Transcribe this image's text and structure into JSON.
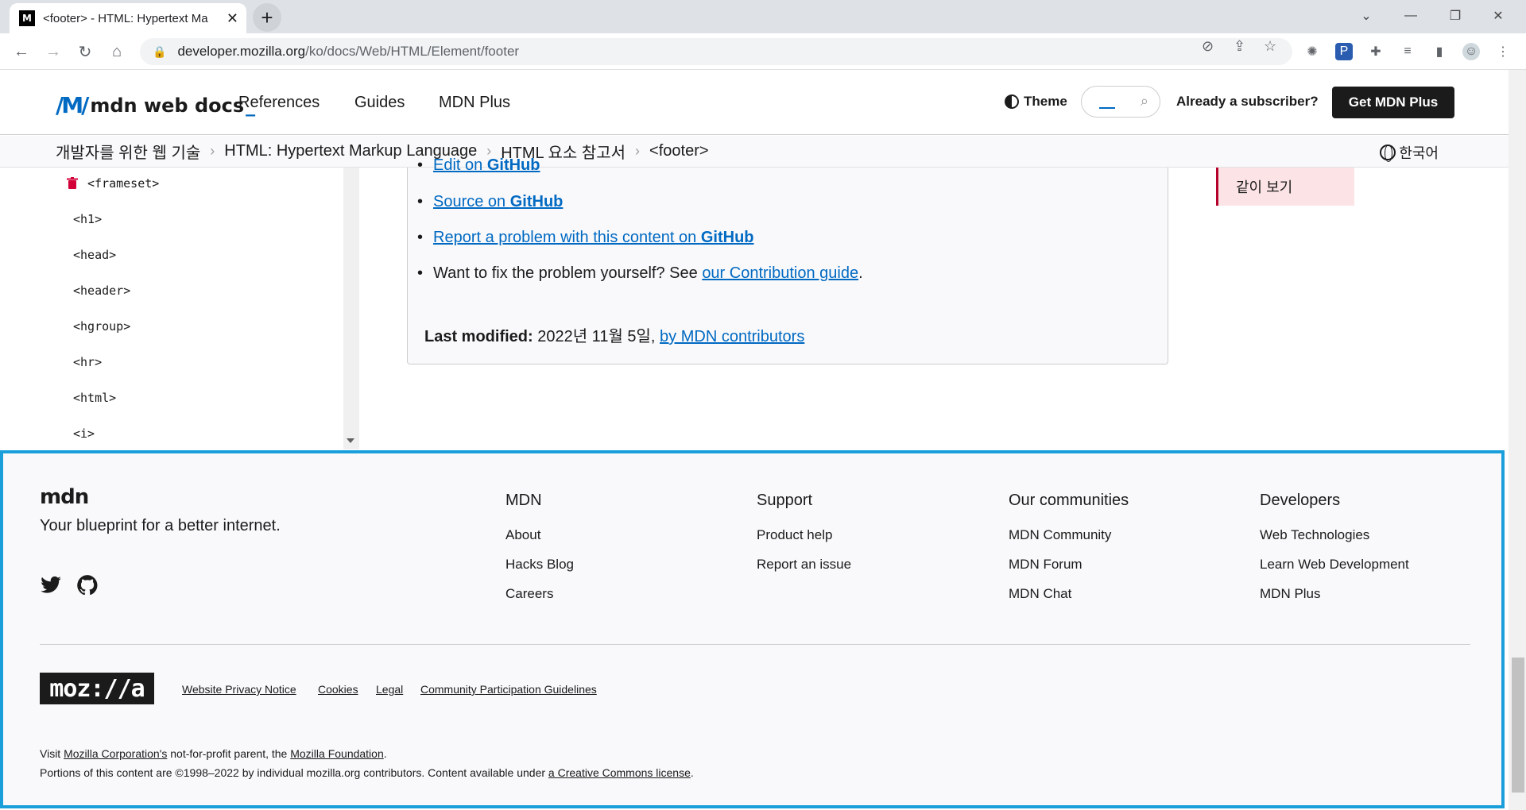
{
  "browser": {
    "tab_title": "<footer> - HTML: Hypertext Ma",
    "tab_favicon": "M",
    "url_host": "developer.mozilla.org",
    "url_path": "/ko/docs/Web/HTML/Element/footer"
  },
  "header": {
    "logo_text": "mdn web docs",
    "nav": [
      "References",
      "Guides",
      "MDN Plus"
    ],
    "theme_label": "Theme",
    "already_label": "Already a subscriber?",
    "get_plus_label": "Get MDN Plus"
  },
  "breadcrumbs": [
    "개발자를 위한 웹 기술",
    "HTML: Hypertext Markup Language",
    "HTML 요소 참고서",
    "<footer>"
  ],
  "language": "한국어",
  "sidebar": {
    "items": [
      "<frameset>",
      "<h1>",
      "<head>",
      "<header>",
      "<hgroup>",
      "<hr>",
      "<html>",
      "<i>"
    ]
  },
  "content": {
    "links": [
      {
        "pre": "",
        "link": "Edit on ",
        "bold": "GitHub",
        "post": ""
      },
      {
        "pre": "",
        "link": "Source on ",
        "bold": "GitHub",
        "post": ""
      },
      {
        "pre": "",
        "link": "Report a problem with this content on ",
        "bold": "GitHub",
        "post": ""
      }
    ],
    "fix_text": "Want to fix the problem yourself? See ",
    "fix_link": "our Contribution guide",
    "fix_end": ".",
    "last_modified_label": "Last modified:",
    "last_modified_date": " 2022년 11월 5일, ",
    "last_modified_link": "by MDN contributors"
  },
  "toc": {
    "see_also": "같이 보기"
  },
  "footer": {
    "logo": "mdn",
    "tagline": "Your blueprint for a better internet.",
    "columns": [
      {
        "title": "MDN",
        "links": [
          "About",
          "Hacks Blog",
          "Careers"
        ]
      },
      {
        "title": "Support",
        "links": [
          "Product help",
          "Report an issue"
        ]
      },
      {
        "title": "Our communities",
        "links": [
          "MDN Community",
          "MDN Forum",
          "MDN Chat"
        ]
      },
      {
        "title": "Developers",
        "links": [
          "Web Technologies",
          "Learn Web Development",
          "MDN Plus"
        ]
      }
    ],
    "mozilla_logo": "moz://a",
    "legal_links": [
      "Website Privacy Notice",
      "Cookies",
      "Legal",
      "Community Participation Guidelines"
    ],
    "visit_pre": "Visit ",
    "visit_link1": "Mozilla Corporation's",
    "visit_mid": " not-for-profit parent, the ",
    "visit_link2": "Mozilla Foundation",
    "visit_end": ".",
    "portions_text": "Portions of this content are ©1998–2022 by individual mozilla.org contributors. Content available under ",
    "portions_link": "a Creative Commons license",
    "portions_end": "."
  },
  "colors": {
    "accent": "#0069c2",
    "highlight_border": "#1a9fdb",
    "toc_bg": "#fce3e6"
  }
}
